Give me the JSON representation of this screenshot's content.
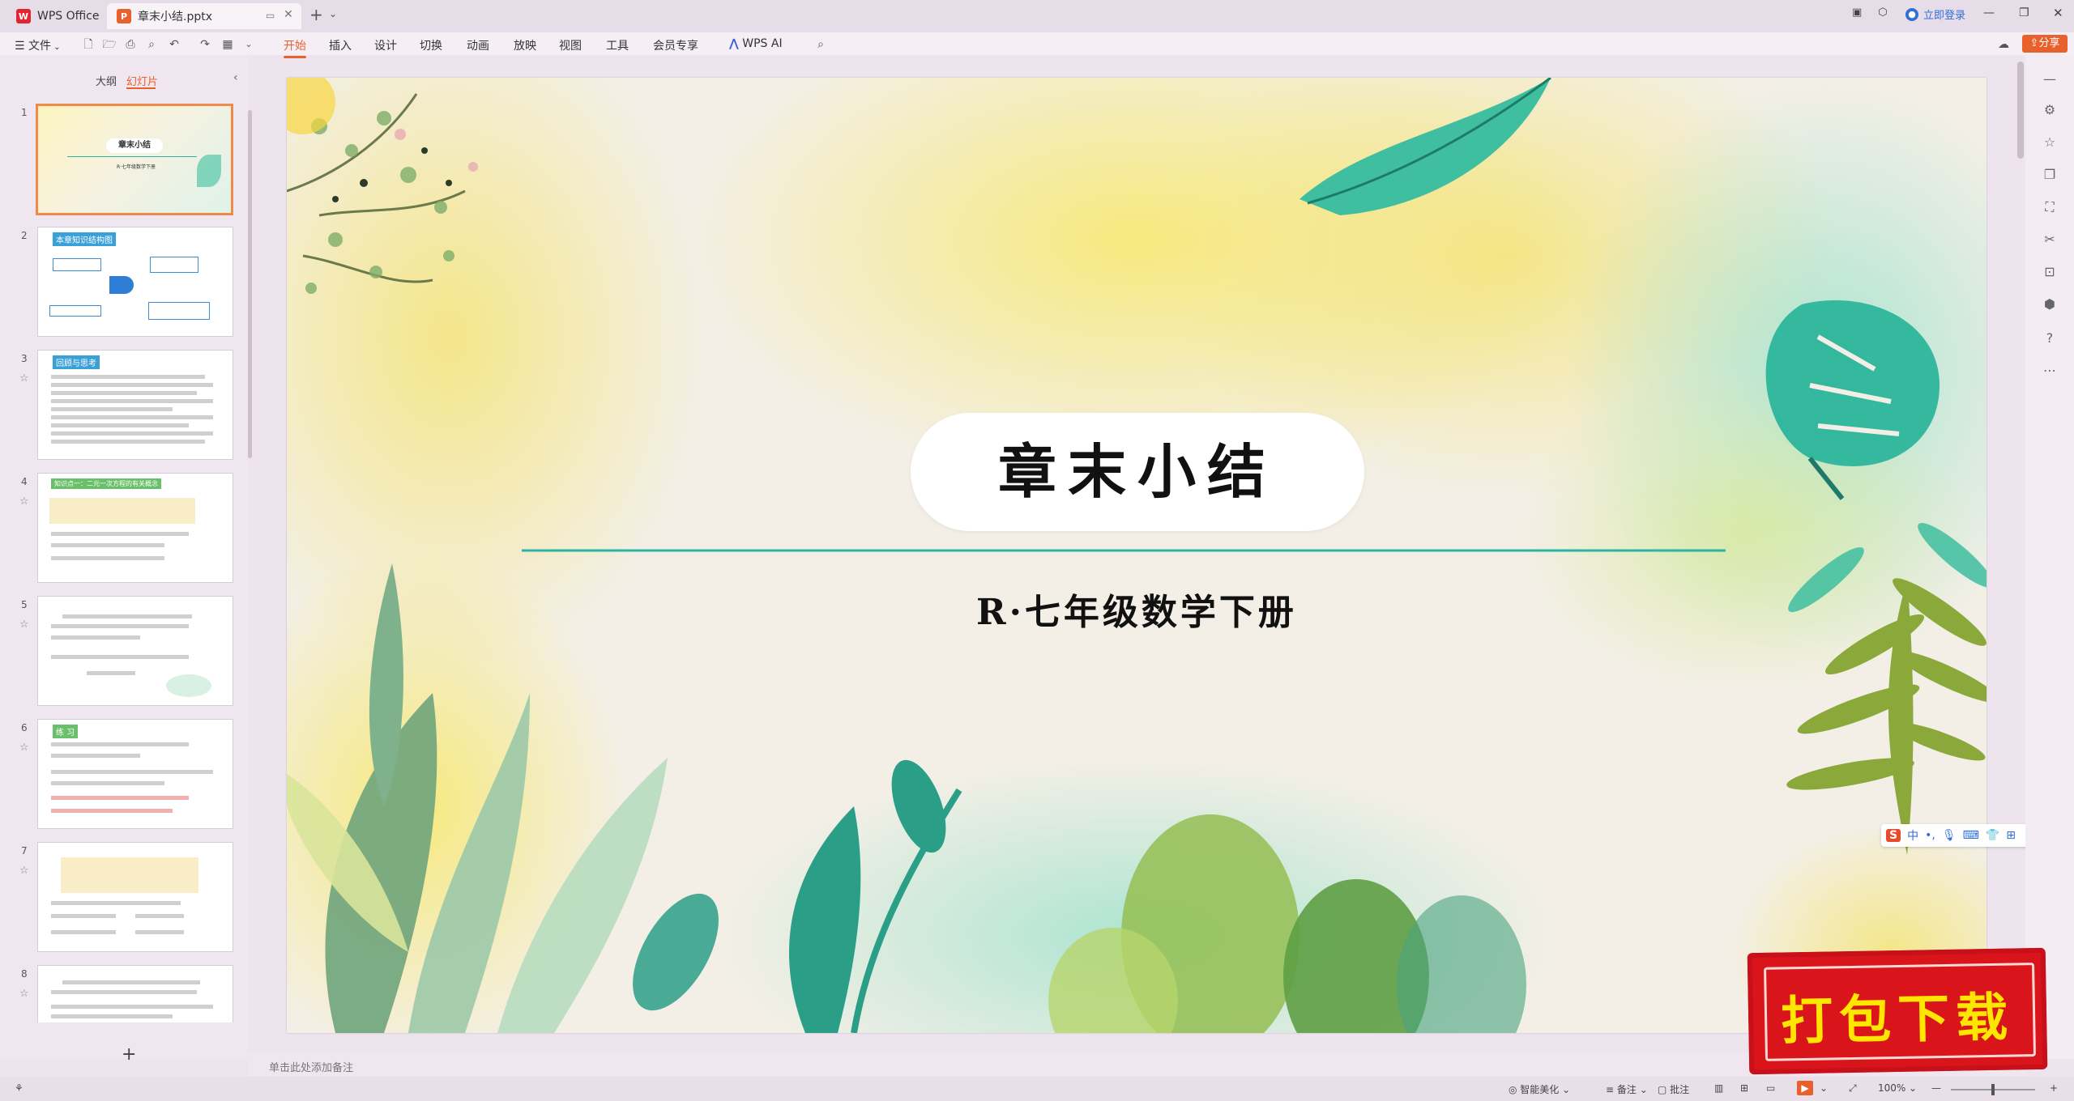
{
  "titlebar": {
    "app_tab": "WPS Office",
    "doc_tab": "章末小结.pptx",
    "login": "立即登录"
  },
  "menu": {
    "file": "文件",
    "items": [
      "开始",
      "插入",
      "设计",
      "切换",
      "动画",
      "放映",
      "视图",
      "工具",
      "会员专享"
    ],
    "ai": "WPS AI",
    "share": "分享"
  },
  "left_panel": {
    "tab_outline": "大纲",
    "tab_slides": "幻灯片",
    "thumbnails": [
      {
        "num": "1",
        "title": "章末小结",
        "subtitle": "R·七年级数学下册"
      },
      {
        "num": "2",
        "title": "本章知识结构图"
      },
      {
        "num": "3",
        "title": "回顾与思考"
      },
      {
        "num": "4",
        "title": "知识点一：二元一次方程的有关概念"
      },
      {
        "num": "5",
        "title": ""
      },
      {
        "num": "6",
        "title": "练 习"
      },
      {
        "num": "7",
        "title": ""
      },
      {
        "num": "8",
        "title": ""
      }
    ],
    "add_button": "+"
  },
  "slide": {
    "title": "章末小结",
    "subtitle": "R·七年级数学下册"
  },
  "ime": {
    "lang": "中"
  },
  "notes": {
    "placeholder": "单击此处添加备注"
  },
  "watermark": {
    "text": "打包下载"
  },
  "statusbar": {
    "beautify": "智能美化",
    "notes": "备注",
    "comments": "批注",
    "zoom": "100%"
  },
  "colors": {
    "accent": "#e8612c",
    "teal": "#2bb3a3",
    "stamp_red": "#d9141b"
  }
}
